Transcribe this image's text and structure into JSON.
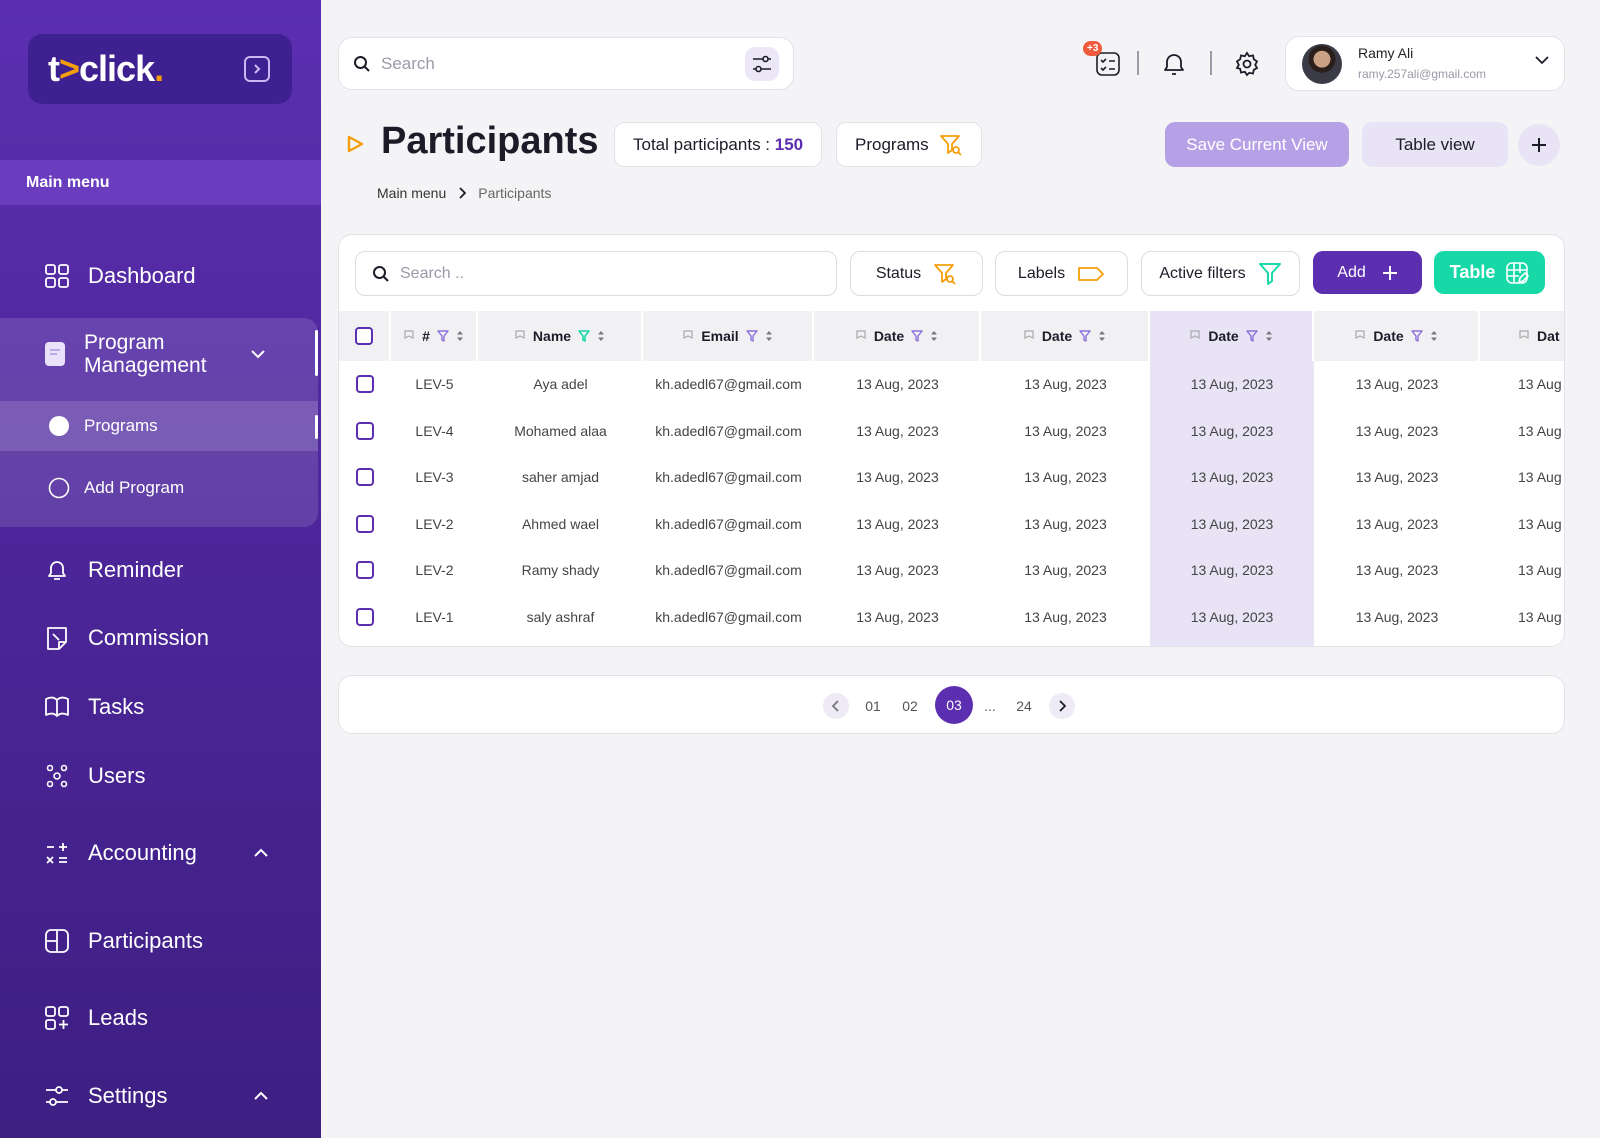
{
  "brand": {
    "logo_t": "t",
    "logo_arrow": ">",
    "logo_rest": "click",
    "logo_dot": "."
  },
  "sidebar": {
    "section_label": "Main menu",
    "items": [
      {
        "label": "Dashboard",
        "icon": "grid-icon"
      },
      {
        "label": "Program Management",
        "icon": "folder-icon"
      },
      {
        "label": "Reminder",
        "icon": "bell-icon"
      },
      {
        "label": "Commission",
        "icon": "receipt-icon"
      },
      {
        "label": "Tasks",
        "icon": "book-icon"
      },
      {
        "label": "Users",
        "icon": "users-icon"
      },
      {
        "label": "Accounting",
        "icon": "calculator-icon"
      },
      {
        "label": "Participants",
        "icon": "participants-icon"
      },
      {
        "label": "Leads",
        "icon": "leads-icon"
      },
      {
        "label": "Settings",
        "icon": "sliders-icon"
      }
    ],
    "sub_items": [
      {
        "label": "Programs"
      },
      {
        "label": "Add Program"
      }
    ]
  },
  "topbar": {
    "search_placeholder": "Search",
    "tasks_badge": "+3",
    "user": {
      "name": "Ramy Ali",
      "email": "ramy.257ali@gmail.com"
    }
  },
  "header": {
    "title": "Participants",
    "total_label": "Total participants : ",
    "total_value": "150",
    "programs_label": "Programs",
    "save_view_label": "Save Current View",
    "table_view_label": "Table view"
  },
  "breadcrumb": {
    "root": "Main menu",
    "current": "Participants"
  },
  "toolbar": {
    "search_placeholder": "Search ..",
    "status_label": "Status",
    "labels_label": "Labels",
    "active_filters_label": "Active filters",
    "add_label": "Add",
    "table_label": "Table"
  },
  "table": {
    "columns": [
      "#",
      "Name",
      "Email",
      "Date",
      "Date",
      "Date",
      "Date",
      "Dat"
    ],
    "rows": [
      {
        "id": "LEV-5",
        "name": "Aya adel",
        "email": "kh.adedl67@gmail.com",
        "d1": "13 Aug, 2023",
        "d2": "13 Aug, 2023",
        "d3": "13 Aug, 2023",
        "d4": "13 Aug, 2023",
        "d5": "13 Aug"
      },
      {
        "id": "LEV-4",
        "name": "Mohamed alaa",
        "email": "kh.adedl67@gmail.com",
        "d1": "13 Aug, 2023",
        "d2": "13 Aug, 2023",
        "d3": "13 Aug, 2023",
        "d4": "13 Aug, 2023",
        "d5": "13 Aug"
      },
      {
        "id": "LEV-3",
        "name": "saher amjad",
        "email": "kh.adedl67@gmail.com",
        "d1": "13 Aug, 2023",
        "d2": "13 Aug, 2023",
        "d3": "13 Aug, 2023",
        "d4": "13 Aug, 2023",
        "d5": "13 Aug"
      },
      {
        "id": "LEV-2",
        "name": "Ahmed wael",
        "email": "kh.adedl67@gmail.com",
        "d1": "13 Aug, 2023",
        "d2": "13 Aug, 2023",
        "d3": "13 Aug, 2023",
        "d4": "13 Aug, 2023",
        "d5": "13 Aug"
      },
      {
        "id": "LEV-2",
        "name": "Ramy shady",
        "email": "kh.adedl67@gmail.com",
        "d1": "13 Aug, 2023",
        "d2": "13 Aug, 2023",
        "d3": "13 Aug, 2023",
        "d4": "13 Aug, 2023",
        "d5": "13 Aug"
      },
      {
        "id": "LEV-1",
        "name": "saly ashraf",
        "email": "kh.adedl67@gmail.com",
        "d1": "13 Aug, 2023",
        "d2": "13 Aug, 2023",
        "d3": "13 Aug, 2023",
        "d4": "13 Aug, 2023",
        "d5": "13 Aug"
      }
    ]
  },
  "pagination": {
    "pages": [
      "01",
      "02",
      "03",
      "...",
      "24"
    ],
    "current": "03"
  },
  "colors": {
    "primary": "#5b2fb0",
    "accent_green": "#17d9a8",
    "accent_orange": "#f59e0b",
    "highlight_column": "#e8e3f5"
  }
}
